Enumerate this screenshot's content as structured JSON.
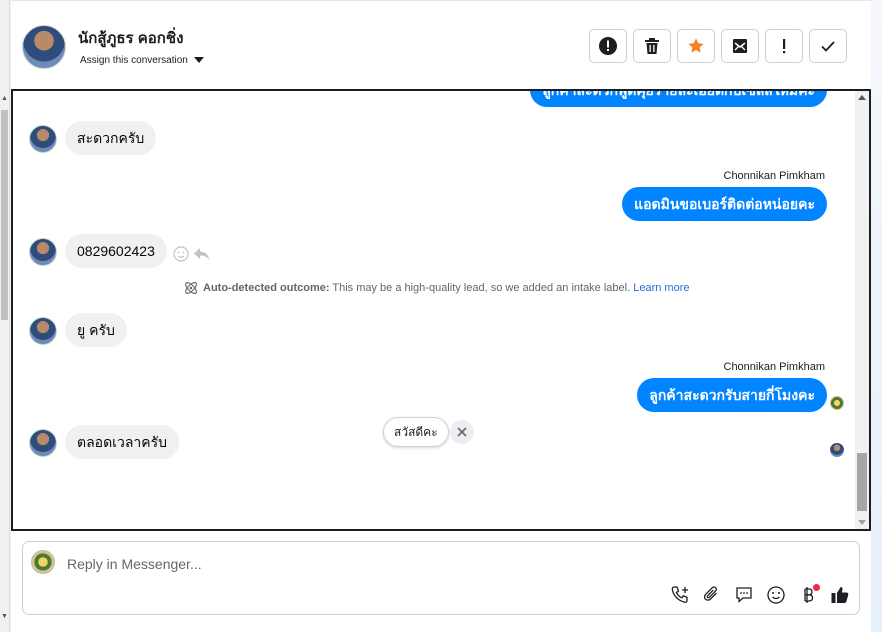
{
  "header": {
    "contact_name": "นักสู้ภูธร คอกชิ่ง",
    "assign_label": "Assign this conversation"
  },
  "actions": [
    {
      "name": "report-icon",
      "glyph": "!"
    },
    {
      "name": "trash-icon",
      "glyph": "🗑"
    },
    {
      "name": "star-icon",
      "glyph": "★"
    },
    {
      "name": "mail-icon",
      "glyph": "✉"
    },
    {
      "name": "exclamation-icon",
      "glyph": "!"
    },
    {
      "name": "check-icon",
      "glyph": "✓"
    }
  ],
  "thread": {
    "top_partial_message": "ลูกค้าสะดวกพูดคุยรายละเอียดกับเซลส์ใหม่คะ",
    "messages": {
      "m1": "สะดวกครับ",
      "sender1": "Chonnikan Pimkham",
      "m2": "แอดมินขอเบอร์ติดต่อหน่อยคะ",
      "m3": "0829602423",
      "m4": "ยู ครับ",
      "sender2": "Chonnikan Pimkham",
      "m5": "ลูกค้าสะดวกรับสายกี่โมงคะ",
      "m6": "ตลอดเวลาครับ"
    },
    "outcome": {
      "title": "Auto-detected outcome:",
      "text": "This may be a high-quality lead, so we added an intake label.",
      "learn_more": "Learn more"
    },
    "suggestion": "สวัสดีคะ"
  },
  "composer": {
    "placeholder": "Reply in Messenger..."
  },
  "colors": {
    "outgoing": "#0084ff",
    "incoming": "#f0f0f0",
    "star": "#f5831f",
    "badge": "#f02849"
  }
}
